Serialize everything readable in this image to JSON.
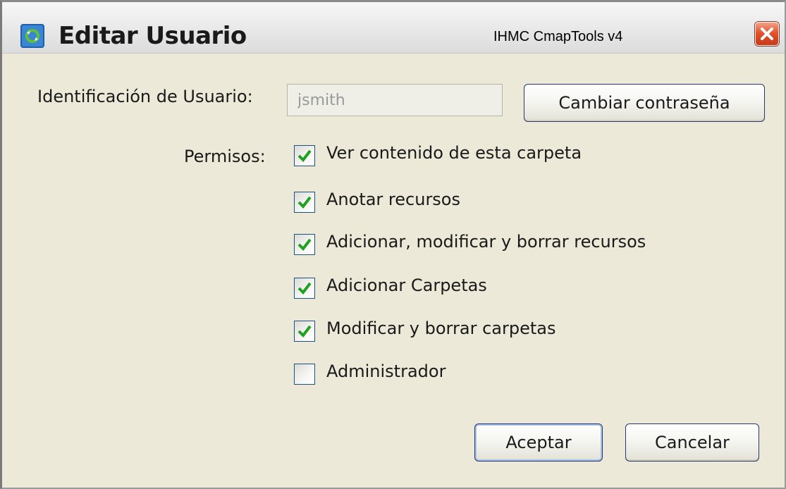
{
  "window": {
    "title": "Editar Usuario",
    "app_name": "IHMC CmapTools v4"
  },
  "form": {
    "user_id_label": "Identificación de Usuario:",
    "user_id_value": "jsmith",
    "change_password_label": "Cambiar contraseña",
    "permissions_label": "Permisos:"
  },
  "permissions": [
    {
      "label": "Ver contenido de esta carpeta",
      "checked": true
    },
    {
      "label": "Anotar recursos",
      "checked": true
    },
    {
      "label": "Adicionar, modificar y borrar recursos",
      "checked": true
    },
    {
      "label": "Adicionar Carpetas",
      "checked": true
    },
    {
      "label": "Modificar y borrar carpetas",
      "checked": true
    },
    {
      "label": "Administrador",
      "checked": false
    }
  ],
  "buttons": {
    "accept_label": "Aceptar",
    "cancel_label": "Cancelar"
  },
  "icons": {
    "app": "cmaptools-app-icon",
    "close": "close-icon",
    "check": "checkmark-icon"
  },
  "colors": {
    "checkmark": "#21a121",
    "close_button": "#e2542e",
    "button_border": "#25376b"
  }
}
